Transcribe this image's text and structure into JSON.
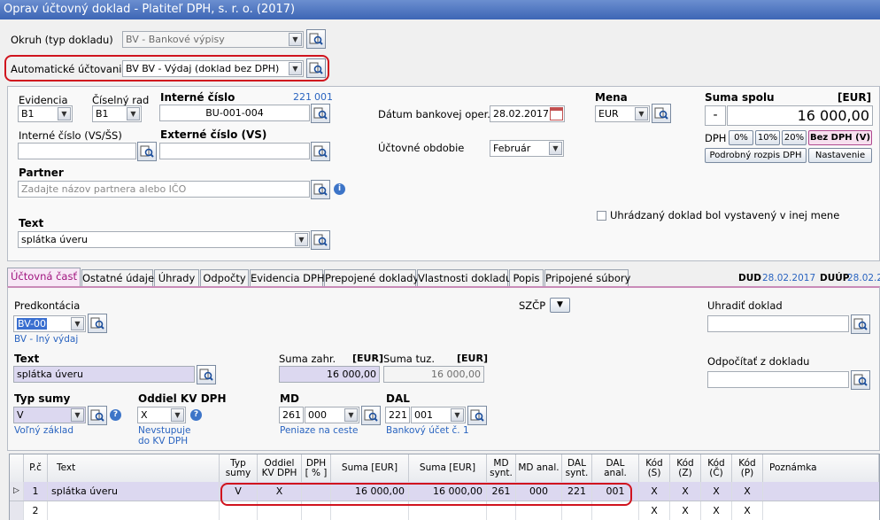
{
  "window": {
    "title": "Oprav účtovný doklad - Platiteľ DPH, s. r. o. (2017)"
  },
  "header": {
    "okruh_label": "Okruh (typ dokladu)",
    "okruh_value": "BV - Bankové výpisy",
    "auto_label": "Automatické účtovanie",
    "auto_value": "BV BV - Výdaj (doklad bez DPH)"
  },
  "doc": {
    "evidencia_label": "Evidencia",
    "evidencia_value": "B1",
    "ciselny_rad_label": "Číselný rad",
    "ciselny_rad_value": "B1",
    "interne_cislo_label": "Interné číslo",
    "interne_cislo_counter_a": "221",
    "interne_cislo_counter_b": "001",
    "interne_cislo_value": "BU-001-004",
    "vs_label": "Interné číslo (VS/ŠS)",
    "vs_value": "",
    "externe_label": "Externé číslo (VS)",
    "externe_value": "",
    "partner_label": "Partner",
    "partner_placeholder": "Zadajte názov partnera alebo IČO",
    "text_label": "Text",
    "text_value": "splátka úveru",
    "datum_label": "Dátum bankovej oper.",
    "datum_value": "28.02.2017",
    "obdobie_label": "Účtovné obdobie",
    "obdobie_value": "Február",
    "mena_label": "Mena",
    "mena_value": "EUR",
    "suma_label": "Suma spolu",
    "suma_unit": "[EUR]",
    "suma_sign": "-",
    "suma_value": "16 000,00",
    "dph_label": "DPH",
    "dph_0": "0%",
    "dph_10": "10%",
    "dph_20": "20%",
    "bez_dph": "Bez DPH (V)",
    "rozpis_btn": "Podrobný rozpis DPH",
    "nastavenie_btn": "Nastavenie",
    "uhradzany_label": "Uhrádzaný doklad bol vystavený v inej mene"
  },
  "tabs": [
    "Účtovná časť",
    "Ostatné údaje",
    "Úhrady",
    "Odpočty",
    "Evidencia DPH",
    "Prepojené doklady",
    "Vlastnosti dokladu",
    "Popis",
    "Pripojené súbory"
  ],
  "dates": {
    "dud_label": "DUD",
    "dud_value": "28.02.2017",
    "duup_label": "DUÚP",
    "duup_value": "28.02.2"
  },
  "ucto": {
    "predkontacia_label": "Predkontácia",
    "predkontacia_value": "BV-00",
    "predkontacia_desc": "BV - Iný výdaj",
    "szcp_label": "SZČP",
    "uhradit_label": "Uhradiť doklad",
    "uhradit_value": "",
    "odpocitat_label": "Odpočítať z dokladu",
    "odpocitat_value": "",
    "text_label": "Text",
    "text_value": "splátka úveru",
    "suma_zahr_label": "Suma zahr.",
    "suma_zahr_unit": "[EUR]",
    "suma_zahr_value": "16 000,00",
    "suma_tuz_label": "Suma tuz.",
    "suma_tuz_unit": "[EUR]",
    "suma_tuz_value": "16 000,00",
    "typ_sumy_label": "Typ sumy",
    "typ_sumy_value": "V",
    "typ_sumy_desc": "Voľný základ",
    "oddiel_label": "Oddiel KV DPH",
    "oddiel_value": "X",
    "oddiel_desc1": "Nevstupuje",
    "oddiel_desc2": "do KV DPH",
    "md_label": "MD",
    "md_synt": "261",
    "md_anal": "000",
    "md_desc": "Peniaze na ceste",
    "dal_label": "DAL",
    "dal_synt": "221",
    "dal_anal": "001",
    "dal_desc": "Bankový účet č. 1"
  },
  "grid": {
    "headers": {
      "pc": "P.č",
      "text": "Text",
      "typ1": "Typ",
      "typ2": "sumy",
      "odd1": "Oddiel",
      "odd2": "KV DPH",
      "dph1": "DPH",
      "dph2": "[ % ]",
      "suma1": "Suma [EUR]",
      "suma2": "Suma [EUR]",
      "md1": "MD",
      "md2": "synt.",
      "mdanal": "MD anal.",
      "dal1": "DAL",
      "dal2": "synt.",
      "dala1": "DAL",
      "dala2": "anal.",
      "kods1": "Kód",
      "kods2": "(S)",
      "kodz1": "Kód",
      "kodz2": "(Z)",
      "kodc1": "Kód",
      "kodc2": "(Č)",
      "kodp1": "Kód",
      "kodp2": "(P)",
      "pozn": "Poznámka"
    },
    "rows": [
      {
        "pc": "1",
        "text": "splátka úveru",
        "typ": "V",
        "oddiel": "X",
        "dph": "",
        "suma1": "16 000,00",
        "suma2": "16 000,00",
        "md": "261",
        "mdanal": "000",
        "dal": "221",
        "dalanal": "001",
        "s": "X",
        "z": "X",
        "c": "X",
        "p": "X"
      },
      {
        "pc": "2",
        "text": "",
        "typ": "",
        "oddiel": "",
        "dph": "",
        "suma1": "",
        "suma2": "",
        "md": "",
        "mdanal": "",
        "dal": "",
        "dalanal": "",
        "s": "X",
        "z": "X",
        "c": "X",
        "p": "X"
      }
    ]
  }
}
